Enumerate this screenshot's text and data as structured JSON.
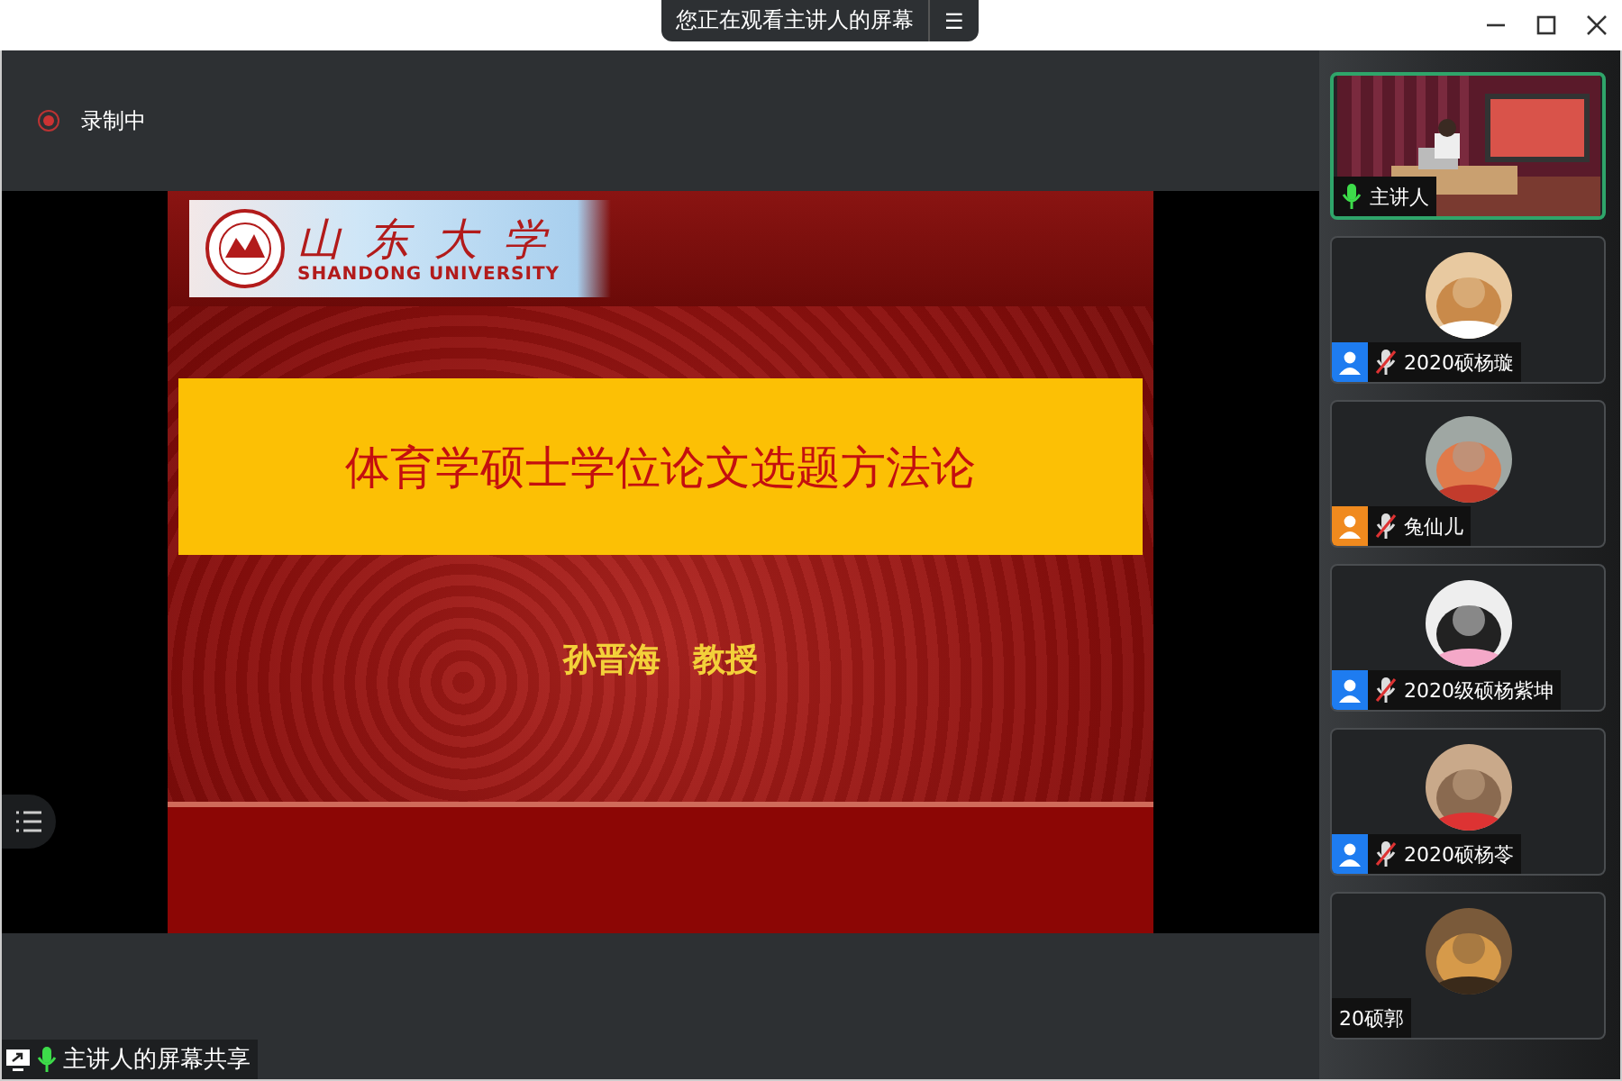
{
  "window": {
    "banner": "您正在观看主讲人的屏幕",
    "banner_icon": "☰"
  },
  "recording": {
    "label": "录制中",
    "on": true
  },
  "slide": {
    "logo_cn": "山东大学",
    "logo_en": "SHANDONG UNIVERSITY",
    "title": "体育学硕士学位论文选题方法论",
    "author": "孙晋海　教授"
  },
  "share_label": {
    "text": "主讲人的屏幕共享",
    "muted": false
  },
  "participants": [
    {
      "kind": "video",
      "name": "主讲人",
      "muted": false,
      "selected": true
    },
    {
      "kind": "avatar",
      "name": "2020硕杨璇",
      "muted": true,
      "color": "#1e7cf0",
      "selected": false
    },
    {
      "kind": "avatar",
      "name": "兔仙儿",
      "muted": true,
      "color": "#f08a1e",
      "selected": false
    },
    {
      "kind": "avatar",
      "name": "2020级硕杨紫坤",
      "muted": true,
      "color": "#1e7cf0",
      "selected": false
    },
    {
      "kind": "avatar",
      "name": "2020硕杨苓",
      "muted": true,
      "color": "#1e7cf0",
      "selected": false
    },
    {
      "kind": "avatar",
      "name": "20硕郭",
      "selected": false
    }
  ]
}
